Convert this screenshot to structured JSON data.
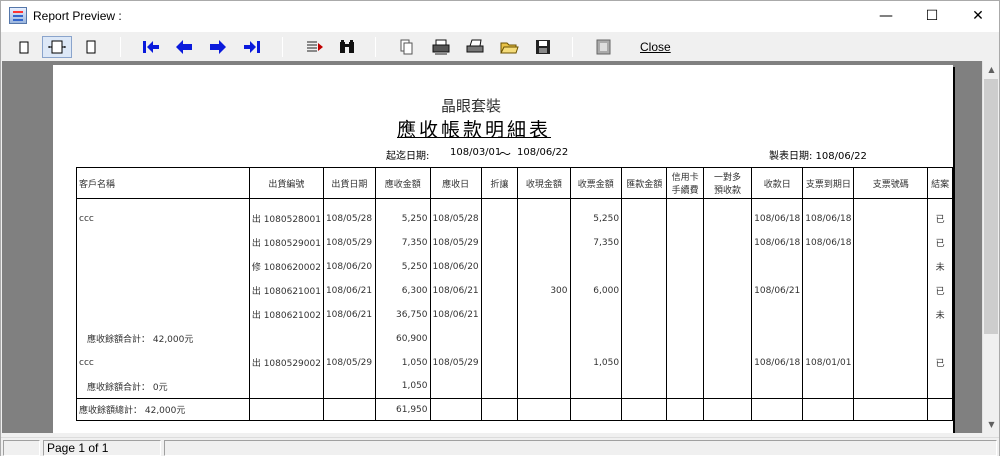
{
  "window": {
    "title": "Report Preview :",
    "min": "—",
    "max": "☐",
    "close": "✕"
  },
  "toolbar": {
    "close_label": "Close"
  },
  "status": {
    "page_text": "Page 1 of 1"
  },
  "report": {
    "company": "晶眼套裝",
    "title": "應收帳款明細表",
    "range_label": "起迄日期:",
    "range_from": "108/03/01",
    "range_sep": "～",
    "range_to": "108/06/22",
    "print_date": "製表日期: 108/06/22",
    "headers": [
      "客戶名稱",
      "出貨編號",
      "出貨日期",
      "應收金額",
      "應收日",
      "折讓",
      "收現金額",
      "收票金額",
      "匯款金額",
      "信用卡\n手續費",
      "一對多\n預收款",
      "收款日",
      "支票到期日",
      "支票號碼",
      "結案"
    ],
    "rows": [
      [
        "ccc",
        "出 1080528001",
        "108/05/28",
        "5,250",
        "108/05/28",
        "",
        "",
        "5,250",
        "",
        "",
        "",
        "108/06/18",
        "108/06/18",
        "",
        "已"
      ],
      [
        "",
        "出 1080529001",
        "108/05/29",
        "7,350",
        "108/05/29",
        "",
        "",
        "7,350",
        "",
        "",
        "",
        "108/06/18",
        "108/06/18",
        "",
        "已"
      ],
      [
        "",
        "修 1080620002",
        "108/06/20",
        "5,250",
        "108/06/20",
        "",
        "",
        "",
        "",
        "",
        "",
        "",
        "",
        "",
        "未"
      ],
      [
        "",
        "出 1080621001",
        "108/06/21",
        "6,300",
        "108/06/21",
        "",
        "300",
        "6,000",
        "",
        "",
        "",
        "108/06/21",
        "",
        "",
        "已"
      ],
      [
        "",
        "出 1080621002",
        "108/06/21",
        "36,750",
        "108/06/21",
        "",
        "",
        "",
        "",
        "",
        "",
        "",
        "",
        "",
        "未"
      ],
      [
        "應收餘額合計：  42,000元",
        "",
        "",
        "60,900",
        "",
        "",
        "",
        "",
        "",
        "",
        "",
        "",
        "",
        "",
        ""
      ],
      [
        "ccc",
        "出 1080529002",
        "108/05/29",
        "1,050",
        "108/05/29",
        "",
        "",
        "1,050",
        "",
        "",
        "",
        "108/06/18",
        "108/01/01",
        "",
        "已"
      ],
      [
        "應收餘額合計：     0元",
        "",
        "",
        "1,050",
        "",
        "",
        "",
        "",
        "",
        "",
        "",
        "",
        "",
        "",
        ""
      ]
    ],
    "total": [
      "應收餘額總計：  42,000元",
      "",
      "",
      "61,950",
      "",
      "",
      "",
      "",
      "",
      "",
      "",
      "",
      "",
      "",
      ""
    ]
  }
}
